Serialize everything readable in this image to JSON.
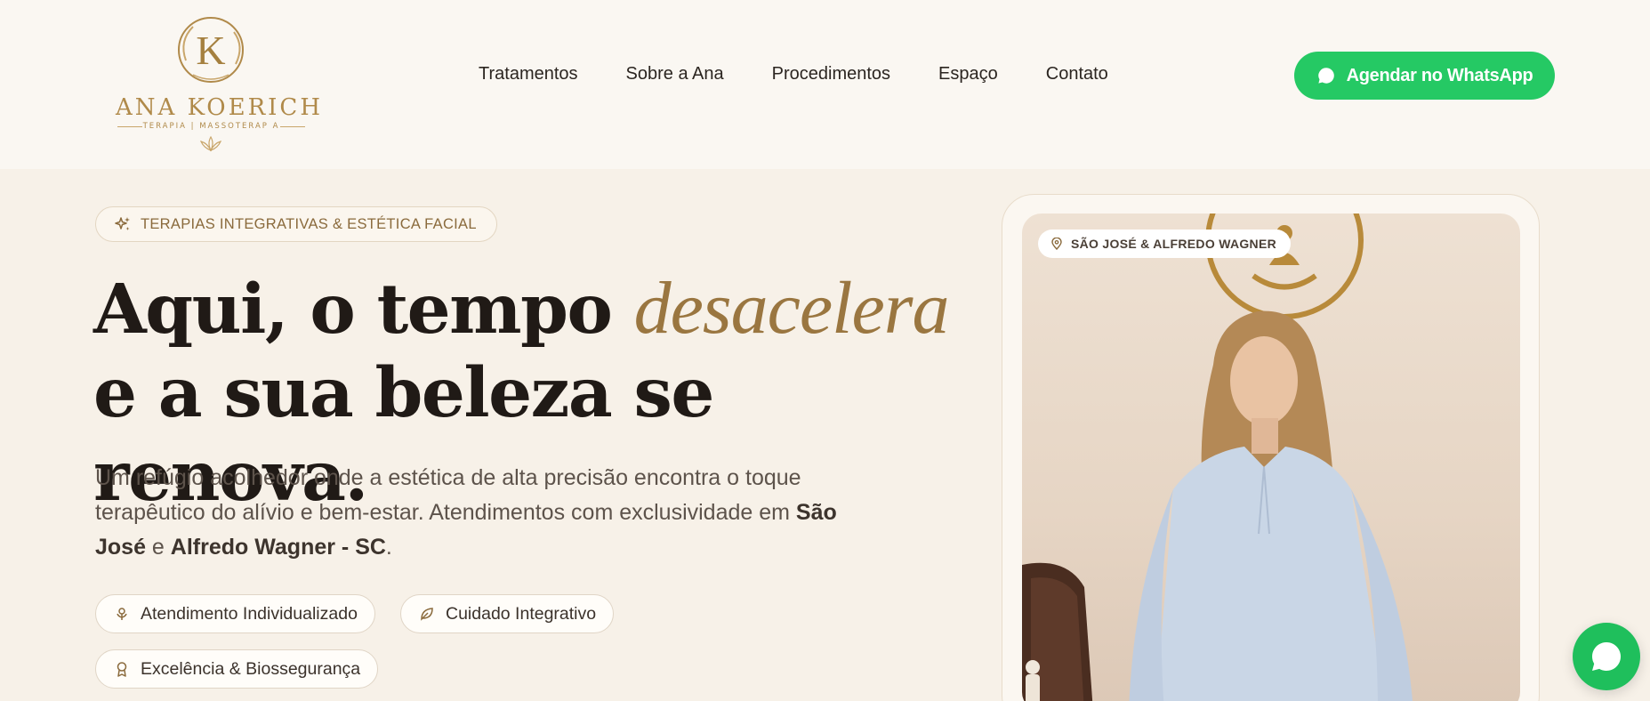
{
  "brand": {
    "name": "ANA KOERICH",
    "tagline": "TERAPIA | MASSOTERAP A",
    "monogram": "K",
    "accent_color": "#b08a4a"
  },
  "nav": {
    "items": [
      {
        "label": "Tratamentos"
      },
      {
        "label": "Sobre a Ana"
      },
      {
        "label": "Procedimentos"
      },
      {
        "label": "Espaço"
      },
      {
        "label": "Contato"
      }
    ]
  },
  "cta": {
    "label": "Agendar no WhatsApp",
    "icon": "whatsapp-icon",
    "color": "#25c964"
  },
  "hero": {
    "badge": "TERAPIAS INTEGRATIVAS & ESTÉTICA FACIAL",
    "headline_part1": "Aqui, o tempo ",
    "headline_accent": "desacelera",
    "headline_part2": " e a sua beleza se renova.",
    "intro_part1": "Um refúgio acolhedor onde a estética de alta precisão encontra o toque terapêutico do alívio e bem-estar. Atendimentos com exclusividade em ",
    "intro_bold1": "São José",
    "intro_mid": " e ",
    "intro_bold2": "Alfredo Wagner - SC",
    "intro_end": ".",
    "pills": [
      {
        "label": "Atendimento Individualizado",
        "icon": "flower-icon"
      },
      {
        "label": "Cuidado Integrativo",
        "icon": "leaf-icon"
      },
      {
        "label": "Excelência & Biossegurança",
        "icon": "award-icon"
      }
    ]
  },
  "photo": {
    "location_badge": "SÃO JOSÉ & ALFREDO WAGNER",
    "location_icon": "map-pin-icon"
  },
  "floating_button": {
    "icon": "whatsapp-chat-icon",
    "color": "#1fbf5c"
  }
}
